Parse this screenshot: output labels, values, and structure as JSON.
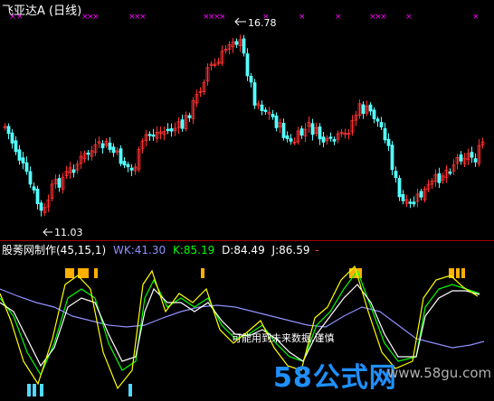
{
  "price_panel": {
    "title": "飞亚达A (日线)",
    "high_label": "16.78",
    "low_label": "11.03"
  },
  "indicator_panel": {
    "name": "股莠网制作(45,15,1)",
    "wk": "WK:41.30",
    "k": "K:85.19",
    "d": "D:84.49",
    "j": "J:86.59",
    "tail": "-",
    "caption": "可能用到未来数据,谨慎"
  },
  "watermark": {
    "main": "58公式网",
    "url": "www.58gu.com"
  },
  "colors": {
    "up_candle": "#ff3232",
    "down_candle": "#54ffff",
    "marker": "#ff00ff",
    "wk": "#9090ff",
    "k": "#00ff00",
    "d": "#ffffff",
    "j": "#ffff00",
    "indicator_name": "#ffffff",
    "divider": "#aa0000"
  }
}
